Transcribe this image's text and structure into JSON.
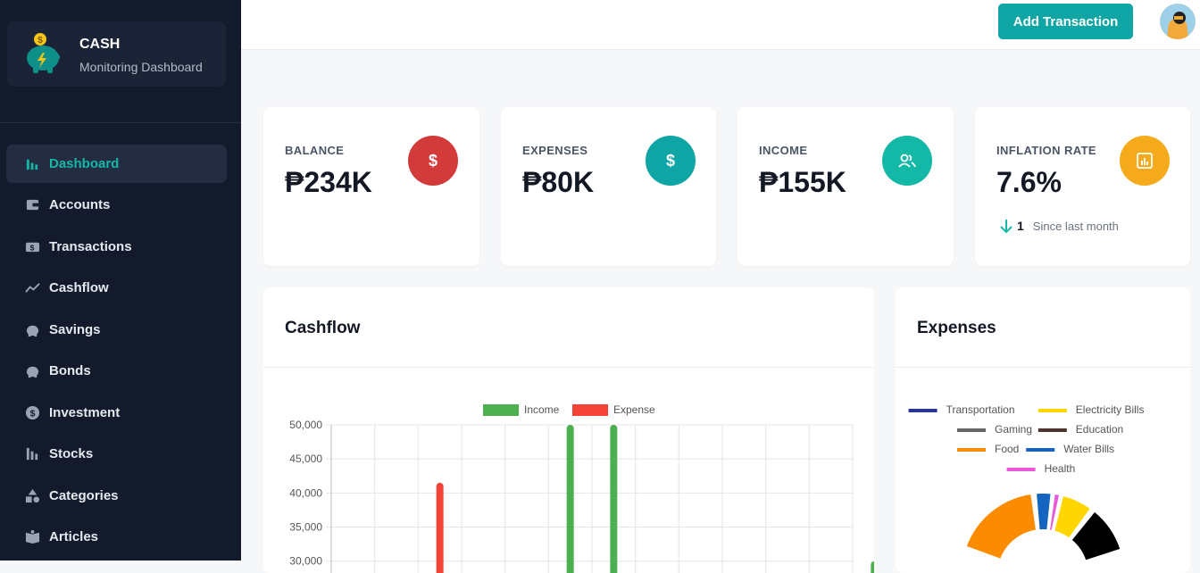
{
  "brand": {
    "title": "CASH",
    "subtitle": "Monitoring Dashboard",
    "logo_icon": "piggy-bank-icon"
  },
  "nav": [
    {
      "label": "Dashboard",
      "icon": "bar-chart-icon",
      "active": true
    },
    {
      "label": "Accounts",
      "icon": "wallet-icon"
    },
    {
      "label": "Transactions",
      "icon": "money-bill-icon"
    },
    {
      "label": "Cashflow",
      "icon": "trend-line-icon"
    },
    {
      "label": "Savings",
      "icon": "piggy-bank-icon"
    },
    {
      "label": "Bonds",
      "icon": "piggy-bank-icon"
    },
    {
      "label": "Investment",
      "icon": "dollar-circle-icon"
    },
    {
      "label": "Stocks",
      "icon": "building-chart-icon"
    },
    {
      "label": "Categories",
      "icon": "shapes-icon"
    },
    {
      "label": "Articles",
      "icon": "book-icon"
    }
  ],
  "topbar": {
    "add_label": "Add Transaction"
  },
  "cards": [
    {
      "label": "BALANCE",
      "value": "₱234K",
      "icon": "dollar-icon",
      "color": "#d33b3b"
    },
    {
      "label": "EXPENSES",
      "value": "₱80K",
      "icon": "dollar-icon",
      "color": "#0ea5a4"
    },
    {
      "label": "INCOME",
      "value": "₱155K",
      "icon": "users-icon",
      "color": "#14b8a6"
    },
    {
      "label": "INFLATION RATE",
      "value": "7.6%",
      "icon": "chart-box-icon",
      "color": "#f5aa1c",
      "change": "1",
      "since": "Since last month"
    }
  ],
  "cashflow": {
    "title": "Cashflow"
  },
  "expenses_panel": {
    "title": "Expenses"
  },
  "chart_data": [
    {
      "type": "bar",
      "title": "Cashflow",
      "series": [
        {
          "name": "Income",
          "color": "#4caf50",
          "values": [
            null,
            null,
            null,
            null,
            null,
            50000,
            50000,
            null,
            null,
            null,
            null,
            null,
            30000
          ]
        },
        {
          "name": "Expense",
          "color": "#f44336",
          "values": [
            null,
            null,
            41500,
            null,
            null,
            null,
            null,
            null,
            null,
            null,
            null,
            null,
            null
          ]
        }
      ],
      "ylim": [
        28000,
        50000
      ],
      "yticks": [
        "50,000",
        "45,000",
        "40,000",
        "35,000",
        "30,000"
      ],
      "ytick_values": [
        50000,
        45000,
        40000,
        35000,
        30000
      ]
    },
    {
      "type": "pie",
      "title": "Expenses",
      "labels": [
        "Transportation",
        "Electricity Bills",
        "Gaming",
        "Education",
        "Food",
        "Water Bills",
        "Health"
      ],
      "colors": [
        "#283593",
        "#ffd600",
        "#666666",
        "#4e342e",
        "#fb8c00",
        "#1565c0",
        "#e858d8"
      ],
      "visible_segments": [
        {
          "label": "Food",
          "color": "#fb8c00"
        },
        {
          "label": "Water Bills",
          "color": "#1565c0"
        },
        {
          "label": "Health",
          "color": "#e858d8"
        },
        {
          "label": "Electricity Bills",
          "color": "#ffd600"
        },
        {
          "label": "Gaming",
          "color": "#000000"
        }
      ]
    }
  ]
}
